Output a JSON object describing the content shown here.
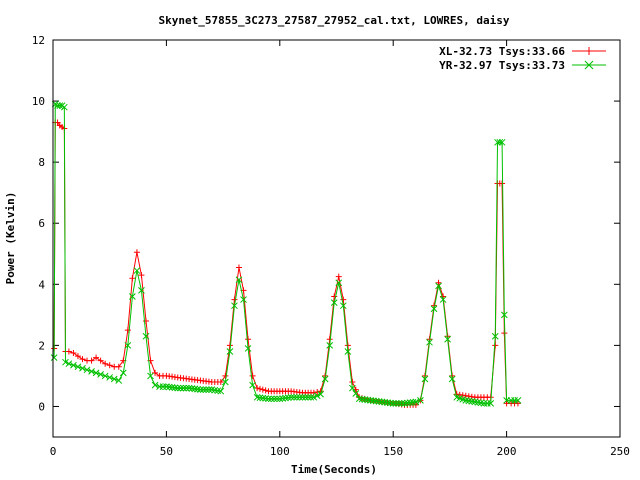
{
  "chart_data": {
    "type": "line",
    "title": "Skynet_57855_3C273_27587_27952_cal.txt, LOWRES, daisy",
    "xlabel": "Time(Seconds)",
    "ylabel": "Power (Kelvin)",
    "xlim": [
      0,
      250
    ],
    "ylim": [
      -1,
      12
    ],
    "xticks": [
      0,
      50,
      100,
      150,
      200,
      250
    ],
    "yticks": [
      0,
      2,
      4,
      6,
      8,
      10,
      12
    ],
    "legend_position": "top-right",
    "series": [
      {
        "name": "XL-32.73 Tsys:33.66",
        "color": "#ff0000",
        "marker": "plus",
        "points": [
          [
            0.5,
            1.9
          ],
          [
            1,
            9.3
          ],
          [
            2,
            9.3
          ],
          [
            3,
            9.2
          ],
          [
            4,
            9.15
          ],
          [
            5,
            9.1
          ],
          [
            5.5,
            1.8
          ],
          [
            7,
            1.8
          ],
          [
            9,
            1.75
          ],
          [
            11,
            1.65
          ],
          [
            13,
            1.55
          ],
          [
            15,
            1.5
          ],
          [
            17,
            1.5
          ],
          [
            19,
            1.6
          ],
          [
            21,
            1.5
          ],
          [
            23,
            1.4
          ],
          [
            25,
            1.35
          ],
          [
            27,
            1.3
          ],
          [
            29,
            1.3
          ],
          [
            31,
            1.5
          ],
          [
            33,
            2.5
          ],
          [
            35,
            4.2
          ],
          [
            37,
            5.05
          ],
          [
            39,
            4.3
          ],
          [
            41,
            2.8
          ],
          [
            43,
            1.5
          ],
          [
            45,
            1.1
          ],
          [
            47,
            1.0
          ],
          [
            50,
            1.0
          ],
          [
            55,
            0.95
          ],
          [
            60,
            0.9
          ],
          [
            65,
            0.85
          ],
          [
            70,
            0.8
          ],
          [
            74,
            0.8
          ],
          [
            76,
            1.0
          ],
          [
            78,
            2.0
          ],
          [
            80,
            3.5
          ],
          [
            82,
            4.55
          ],
          [
            84,
            3.8
          ],
          [
            86,
            2.2
          ],
          [
            88,
            1.0
          ],
          [
            90,
            0.6
          ],
          [
            95,
            0.5
          ],
          [
            100,
            0.5
          ],
          [
            105,
            0.5
          ],
          [
            110,
            0.45
          ],
          [
            115,
            0.45
          ],
          [
            118,
            0.5
          ],
          [
            120,
            1.0
          ],
          [
            122,
            2.2
          ],
          [
            124,
            3.6
          ],
          [
            126,
            4.25
          ],
          [
            128,
            3.5
          ],
          [
            130,
            2.0
          ],
          [
            132,
            0.8
          ],
          [
            135,
            0.3
          ],
          [
            140,
            0.2
          ],
          [
            145,
            0.15
          ],
          [
            150,
            0.1
          ],
          [
            155,
            0.05
          ],
          [
            160,
            0.05
          ],
          [
            162,
            0.2
          ],
          [
            164,
            1.0
          ],
          [
            166,
            2.2
          ],
          [
            168,
            3.3
          ],
          [
            170,
            4.05
          ],
          [
            172,
            3.6
          ],
          [
            174,
            2.3
          ],
          [
            176,
            1.0
          ],
          [
            178,
            0.4
          ],
          [
            182,
            0.35
          ],
          [
            186,
            0.3
          ],
          [
            190,
            0.3
          ],
          [
            193,
            0.3
          ],
          [
            195,
            2.0
          ],
          [
            196,
            7.3
          ],
          [
            197,
            7.3
          ],
          [
            198,
            7.3
          ],
          [
            199,
            2.4
          ],
          [
            200,
            0.1
          ],
          [
            202,
            0.1
          ],
          [
            205,
            0.1
          ]
        ]
      },
      {
        "name": "YR-32.97 Tsys:33.73",
        "color": "#00c000",
        "marker": "cross",
        "points": [
          [
            0.5,
            1.6
          ],
          [
            1,
            9.9
          ],
          [
            2,
            9.85
          ],
          [
            3,
            9.85
          ],
          [
            4,
            9.85
          ],
          [
            5,
            9.8
          ],
          [
            5.5,
            1.45
          ],
          [
            7,
            1.4
          ],
          [
            9,
            1.35
          ],
          [
            11,
            1.3
          ],
          [
            13,
            1.25
          ],
          [
            15,
            1.2
          ],
          [
            17,
            1.15
          ],
          [
            19,
            1.1
          ],
          [
            21,
            1.05
          ],
          [
            23,
            1.0
          ],
          [
            25,
            0.95
          ],
          [
            27,
            0.9
          ],
          [
            29,
            0.85
          ],
          [
            31,
            1.1
          ],
          [
            33,
            2.0
          ],
          [
            35,
            3.6
          ],
          [
            37,
            4.45
          ],
          [
            39,
            3.8
          ],
          [
            41,
            2.3
          ],
          [
            43,
            1.0
          ],
          [
            45,
            0.7
          ],
          [
            47,
            0.65
          ],
          [
            50,
            0.65
          ],
          [
            55,
            0.6
          ],
          [
            60,
            0.6
          ],
          [
            65,
            0.55
          ],
          [
            70,
            0.55
          ],
          [
            74,
            0.5
          ],
          [
            76,
            0.8
          ],
          [
            78,
            1.8
          ],
          [
            80,
            3.3
          ],
          [
            82,
            4.15
          ],
          [
            84,
            3.5
          ],
          [
            86,
            1.9
          ],
          [
            88,
            0.7
          ],
          [
            90,
            0.3
          ],
          [
            95,
            0.25
          ],
          [
            100,
            0.25
          ],
          [
            105,
            0.3
          ],
          [
            110,
            0.3
          ],
          [
            115,
            0.3
          ],
          [
            118,
            0.4
          ],
          [
            120,
            0.9
          ],
          [
            122,
            2.0
          ],
          [
            124,
            3.4
          ],
          [
            126,
            4.05
          ],
          [
            128,
            3.3
          ],
          [
            130,
            1.8
          ],
          [
            132,
            0.6
          ],
          [
            135,
            0.25
          ],
          [
            140,
            0.2
          ],
          [
            145,
            0.15
          ],
          [
            150,
            0.1
          ],
          [
            155,
            0.1
          ],
          [
            160,
            0.15
          ],
          [
            162,
            0.2
          ],
          [
            164,
            0.9
          ],
          [
            166,
            2.1
          ],
          [
            168,
            3.2
          ],
          [
            170,
            3.95
          ],
          [
            172,
            3.5
          ],
          [
            174,
            2.2
          ],
          [
            176,
            0.9
          ],
          [
            178,
            0.3
          ],
          [
            182,
            0.2
          ],
          [
            186,
            0.15
          ],
          [
            190,
            0.1
          ],
          [
            193,
            0.1
          ],
          [
            195,
            2.3
          ],
          [
            196,
            8.65
          ],
          [
            197,
            8.65
          ],
          [
            198,
            8.65
          ],
          [
            199,
            3.0
          ],
          [
            200,
            0.2
          ],
          [
            202,
            0.2
          ],
          [
            205,
            0.2
          ]
        ]
      }
    ]
  }
}
